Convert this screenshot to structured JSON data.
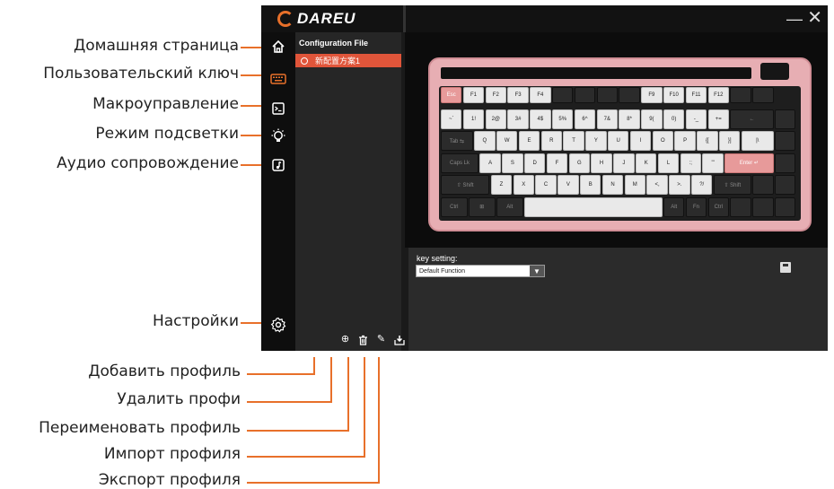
{
  "app": {
    "logo_text": "DAREU",
    "window_controls": {
      "minimize": "—",
      "close": "✕"
    },
    "accent_color": "#e8702a",
    "selected_color": "#e0553a"
  },
  "sidebar": {
    "items": [
      {
        "icon": "home-icon",
        "annotation": "Домашняя страница"
      },
      {
        "icon": "keyboard-icon",
        "annotation": "Пользовательский ключ"
      },
      {
        "icon": "terminal-icon",
        "annotation": "Макроуправление"
      },
      {
        "icon": "bulb-icon",
        "annotation": "Режим подсветки"
      },
      {
        "icon": "music-icon",
        "annotation": "Аудио сопровождение"
      }
    ],
    "settings": {
      "icon": "gear-icon",
      "annotation": "Настройки"
    }
  },
  "profiles": {
    "title": "Configuration File",
    "items": [
      "新配置方案1"
    ],
    "tools": [
      {
        "icon": "add-icon",
        "glyph": "⊕",
        "annotation": "Добавить профиль"
      },
      {
        "icon": "trash-icon",
        "glyph": "🗑",
        "annotation": "Удалить профи"
      },
      {
        "icon": "pencil-icon",
        "glyph": "✎",
        "annotation": "Переименовать профиль"
      },
      {
        "icon": "import-icon",
        "glyph": "⬇",
        "annotation": "Импорт профиля"
      },
      {
        "icon": "export-icon",
        "glyph": "⬈",
        "annotation": "Экспорт профиля"
      }
    ]
  },
  "keyboard": {
    "rows": [
      [
        [
          "Esc",
          "p",
          1
        ],
        [
          "F1",
          "w",
          1
        ],
        [
          "F2",
          "w",
          1
        ],
        [
          "F3",
          "w",
          1
        ],
        [
          "F4",
          "w",
          1
        ],
        [
          "",
          "d",
          1
        ],
        [
          "",
          "d",
          1
        ],
        [
          "",
          "d",
          1
        ],
        [
          "",
          "d",
          1
        ],
        [
          "F9",
          "w",
          1
        ],
        [
          "F10",
          "w",
          1
        ],
        [
          "F11",
          "w",
          1
        ],
        [
          "F12",
          "w",
          1
        ],
        [
          "",
          "d",
          1
        ],
        [
          "",
          "d",
          1
        ]
      ],
      [
        [
          "~`",
          "w",
          1
        ],
        [
          "1!",
          "w",
          1
        ],
        [
          "2@",
          "w",
          1
        ],
        [
          "3#",
          "w",
          1
        ],
        [
          "4$",
          "w",
          1
        ],
        [
          "5%",
          "w",
          1
        ],
        [
          "6^",
          "w",
          1
        ],
        [
          "7&",
          "w",
          1
        ],
        [
          "8*",
          "w",
          1
        ],
        [
          "9(",
          "w",
          1
        ],
        [
          "0)",
          "w",
          1
        ],
        [
          "-_",
          "w",
          1
        ],
        [
          "+=",
          "w",
          1
        ],
        [
          "←",
          "d",
          2
        ],
        [
          "",
          "d",
          1
        ]
      ],
      [
        [
          "Tab ⇆",
          "d",
          1.5
        ],
        [
          "Q",
          "w",
          1
        ],
        [
          "W",
          "w",
          1
        ],
        [
          "E",
          "w",
          1
        ],
        [
          "R",
          "w",
          1
        ],
        [
          "T",
          "w",
          1
        ],
        [
          "Y",
          "w",
          1
        ],
        [
          "U",
          "w",
          1
        ],
        [
          "I",
          "w",
          1
        ],
        [
          "O",
          "w",
          1
        ],
        [
          "P",
          "w",
          1
        ],
        [
          "{[",
          "w",
          1
        ],
        [
          "}]",
          "w",
          1
        ],
        [
          "|\\",
          "w",
          1.5
        ],
        [
          "",
          "d",
          1
        ]
      ],
      [
        [
          "Caps Lk",
          "d",
          1.75
        ],
        [
          "A",
          "w",
          1
        ],
        [
          "S",
          "w",
          1
        ],
        [
          "D",
          "w",
          1
        ],
        [
          "F",
          "w",
          1
        ],
        [
          "G",
          "w",
          1
        ],
        [
          "H",
          "w",
          1
        ],
        [
          "J",
          "w",
          1
        ],
        [
          "K",
          "w",
          1
        ],
        [
          "L",
          "w",
          1
        ],
        [
          ":;",
          "w",
          1
        ],
        [
          "\"'",
          "w",
          1
        ],
        [
          "Enter ↵",
          "p",
          2.25
        ],
        [
          "",
          "d",
          1
        ]
      ],
      [
        [
          "⇧ Shift",
          "d",
          2.25
        ],
        [
          "Z",
          "w",
          1
        ],
        [
          "X",
          "w",
          1
        ],
        [
          "C",
          "w",
          1
        ],
        [
          "V",
          "w",
          1
        ],
        [
          "B",
          "w",
          1
        ],
        [
          "N",
          "w",
          1
        ],
        [
          "M",
          "w",
          1
        ],
        [
          "<,",
          "w",
          1
        ],
        [
          ">.",
          "w",
          1
        ],
        [
          "?/",
          "w",
          1
        ],
        [
          "⇧ Shift",
          "d",
          1.75
        ],
        [
          "",
          "d",
          1
        ],
        [
          "",
          "d",
          1
        ]
      ],
      [
        [
          "Ctrl",
          "d",
          1.25
        ],
        [
          "⊞",
          "d",
          1.25
        ],
        [
          "Alt",
          "d",
          1.25
        ],
        [
          "",
          "w",
          6.25
        ],
        [
          "Alt",
          "d",
          1
        ],
        [
          "Fn",
          "d",
          1
        ],
        [
          "Ctrl",
          "d",
          1
        ],
        [
          "",
          "d",
          1
        ],
        [
          "",
          "d",
          1
        ],
        [
          "",
          "d",
          1
        ]
      ]
    ]
  },
  "key_setting": {
    "label": "key setting:",
    "value": "Default Function",
    "arrow": "▼"
  }
}
